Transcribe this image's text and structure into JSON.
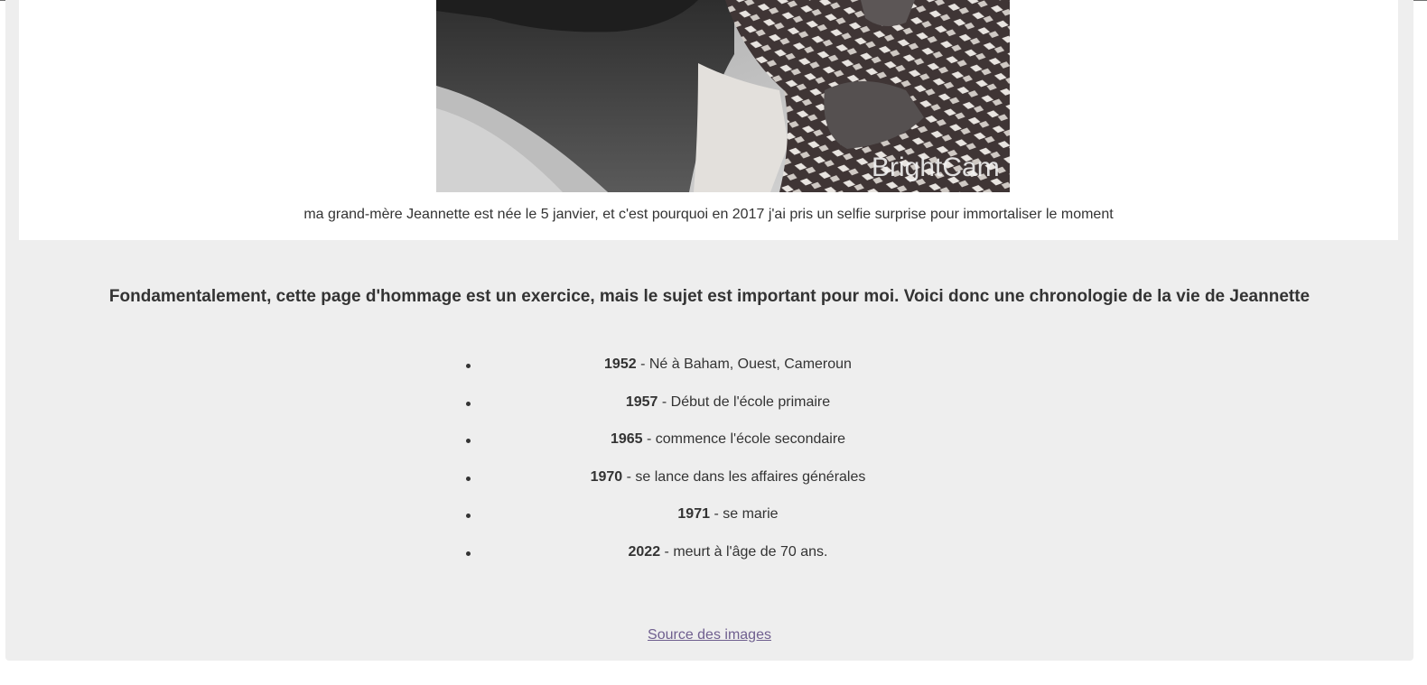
{
  "image": {
    "watermark": "BrightCam",
    "caption": "ma grand-mère Jeannette est née le 5 janvier, et c'est pourquoi en 2017 j'ai pris un selfie surprise pour immortaliser le moment"
  },
  "tribute": {
    "heading": "Fondamentalement, cette page d'hommage est un exercice, mais le sujet est important pour moi. Voici donc une chronologie de la vie de Jeannette"
  },
  "timeline": [
    {
      "year": "1952",
      "event": " - Né à Baham, Ouest, Cameroun"
    },
    {
      "year": "1957",
      "event": " - Début de l'école primaire"
    },
    {
      "year": "1965",
      "event": " - commence l'école secondaire"
    },
    {
      "year": "1970",
      "event": " - se lance dans les affaires générales"
    },
    {
      "year": "1971",
      "event": " - se marie"
    },
    {
      "year": "2022",
      "event": " - meurt à l'âge de 70 ans."
    }
  ],
  "footer": {
    "source_link": "Source des images"
  },
  "colors": {
    "page_background": "#eeeeee",
    "card_background": "#ffffff",
    "text": "#333333",
    "link": "#6f5f8f"
  }
}
